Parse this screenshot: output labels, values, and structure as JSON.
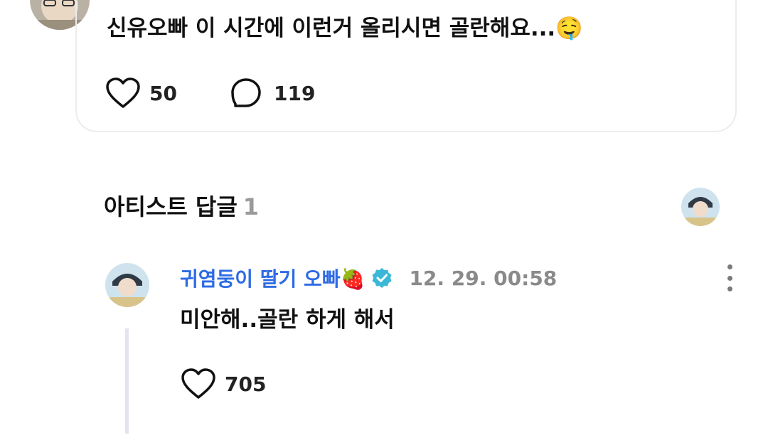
{
  "post": {
    "text": "신유오빠 이 시간에 이런거 올리시면 골란해요...",
    "emoji": "🤤",
    "likes": "50",
    "comments": "119"
  },
  "artist_replies": {
    "title": "아티스트 답글",
    "count": "1"
  },
  "reply": {
    "author": "귀염둥이 딸기 오빠",
    "author_emoji": "🍓",
    "time": "12. 29. 00:58",
    "text": "미안해..골란 하게 해서",
    "likes": "705"
  },
  "colors": {
    "author_blue": "#2d6be4",
    "verified_teal": "#3bb8d8",
    "muted_gray": "#8a8a8a"
  },
  "icons": [
    "heart-icon",
    "comment-icon",
    "verified-badge-icon",
    "more-vertical-icon"
  ]
}
